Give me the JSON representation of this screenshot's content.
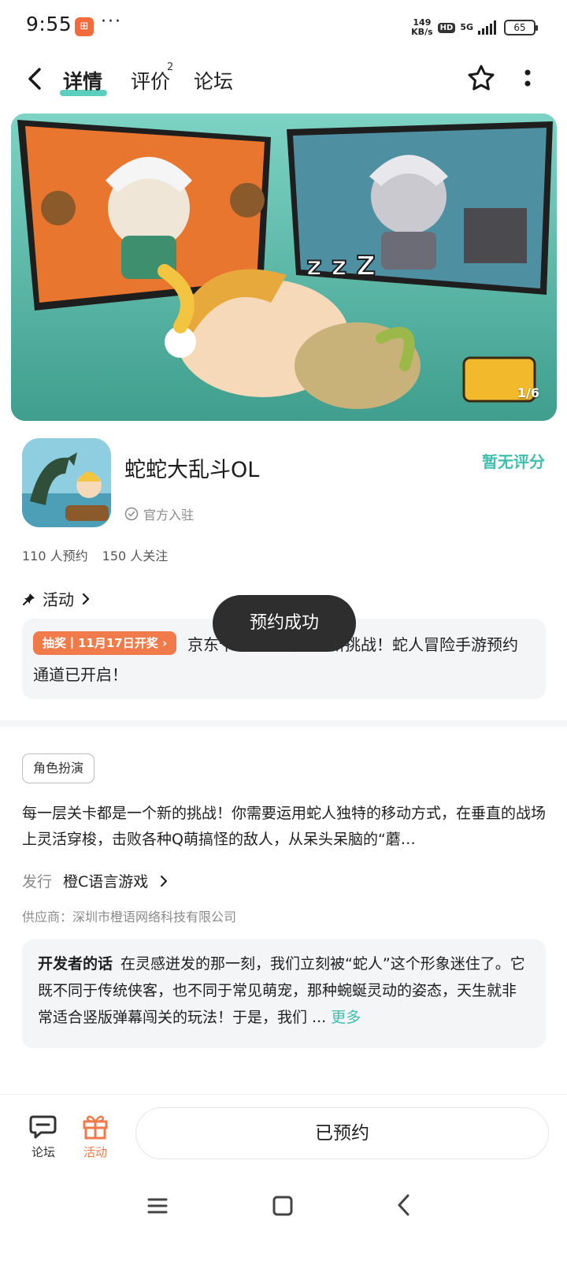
{
  "status_bar": {
    "time": "9:55",
    "more": "···",
    "net_speed_value": "149",
    "net_speed_unit": "KB/s",
    "hd": "HD",
    "net_type": "5G",
    "battery": "65"
  },
  "header": {
    "tabs": [
      {
        "label": "详情"
      },
      {
        "label": "评价",
        "count": "2"
      },
      {
        "label": "论坛"
      }
    ]
  },
  "banner": {
    "counter": "1/6"
  },
  "app": {
    "title": "蛇蛇大乱斗OL",
    "official": "官方入驻",
    "rating": "暂无评分",
    "reservations": "110 人预约",
    "followers": "150 人关注"
  },
  "activity": {
    "heading": "活动",
    "tag": "抽奖丨11月17日开奖",
    "text": "京东卡、每一层都是新挑战！蛇人冒险手游预约通道已开启！"
  },
  "toast": {
    "message": "预约成功"
  },
  "details": {
    "genre": "角色扮演",
    "description": "每一层关卡都是一个新的挑战！你需要运用蛇人独特的移动方式，在垂直的战场上灵活穿梭，击败各种Q萌搞怪的敌人，从呆头呆脑的“蘑…",
    "publisher_label": "发行",
    "publisher_name": "橙C语言游戏",
    "supplier": "供应商：深圳市橙语网络科技有限公司"
  },
  "developer_note": {
    "label": "开发者的话",
    "text": "在灵感迸发的那一刻，我们立刻被“蛇人”这个形象迷住了。它既不同于传统侠客，也不同于常见萌宠，那种蜿蜒灵动的姿态，天生就非常适合竖版弹幕闯关的玩法！于是，我们 ...",
    "more": "更多"
  },
  "bottom_bar": {
    "forum": "论坛",
    "activity": "活动",
    "reserved": "已预约"
  },
  "colors": {
    "accent_teal": "#3fbfae",
    "accent_orange": "#f07a4a",
    "toast_bg": "#2e2e2e"
  }
}
